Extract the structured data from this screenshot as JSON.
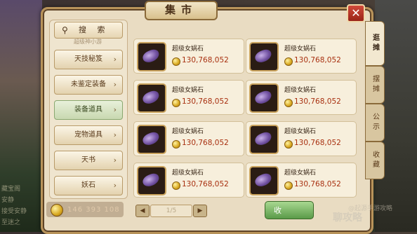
{
  "window": {
    "title": "集市",
    "close_symbol": "✕"
  },
  "sidebar": {
    "search_label": "搜 索",
    "partial_item": "超级神小游",
    "categories": [
      {
        "label": "天技秘笈",
        "active": false
      },
      {
        "label": "未鉴定装备",
        "active": false
      },
      {
        "label": "装备道具",
        "active": true
      },
      {
        "label": "宠物道具",
        "active": false
      },
      {
        "label": "天书",
        "active": false
      },
      {
        "label": "妖石",
        "active": false
      }
    ],
    "arrow_symbol": "›"
  },
  "items": [
    {
      "name": "超级女娲石",
      "price": "130,768,052",
      "icon": "purple-gem-icon"
    },
    {
      "name": "超级女娲石",
      "price": "130,768,052",
      "icon": "purple-gem-icon"
    },
    {
      "name": "超级女娲石",
      "price": "130,768,052",
      "icon": "purple-gem-icon"
    },
    {
      "name": "超级女娲石",
      "price": "130,768,052",
      "icon": "purple-gem-icon"
    },
    {
      "name": "超级女娲石",
      "price": "130,768,052",
      "icon": "purple-gem-icon"
    },
    {
      "name": "超级女娲石",
      "price": "130,768,052",
      "icon": "purple-gem-icon"
    },
    {
      "name": "超级女娲石",
      "price": "130,768,052",
      "icon": "purple-gem-icon"
    },
    {
      "name": "超级女娲石",
      "price": "130,768,052",
      "icon": "purple-gem-icon"
    }
  ],
  "right_tabs": [
    {
      "label": "逛摊",
      "active": true
    },
    {
      "label": "摆摊",
      "active": false
    },
    {
      "label": "公示",
      "active": false
    },
    {
      "label": "收藏",
      "active": false
    }
  ],
  "footer": {
    "money": "146 393 108",
    "page_label": "1/5",
    "prev_symbol": "◀",
    "next_symbol": "▶",
    "collect_label": "收"
  },
  "background": {
    "chat_lines": [
      "藏宝阁",
      "安静",
      "接受安静",
      "至迷之"
    ],
    "watermark": "聊攻略",
    "watermark_sub": "@起源手游攻略"
  },
  "colors": {
    "price": "#a83010",
    "frame_gold": "#b8935a",
    "panel_bg": "#e9dcc2"
  }
}
